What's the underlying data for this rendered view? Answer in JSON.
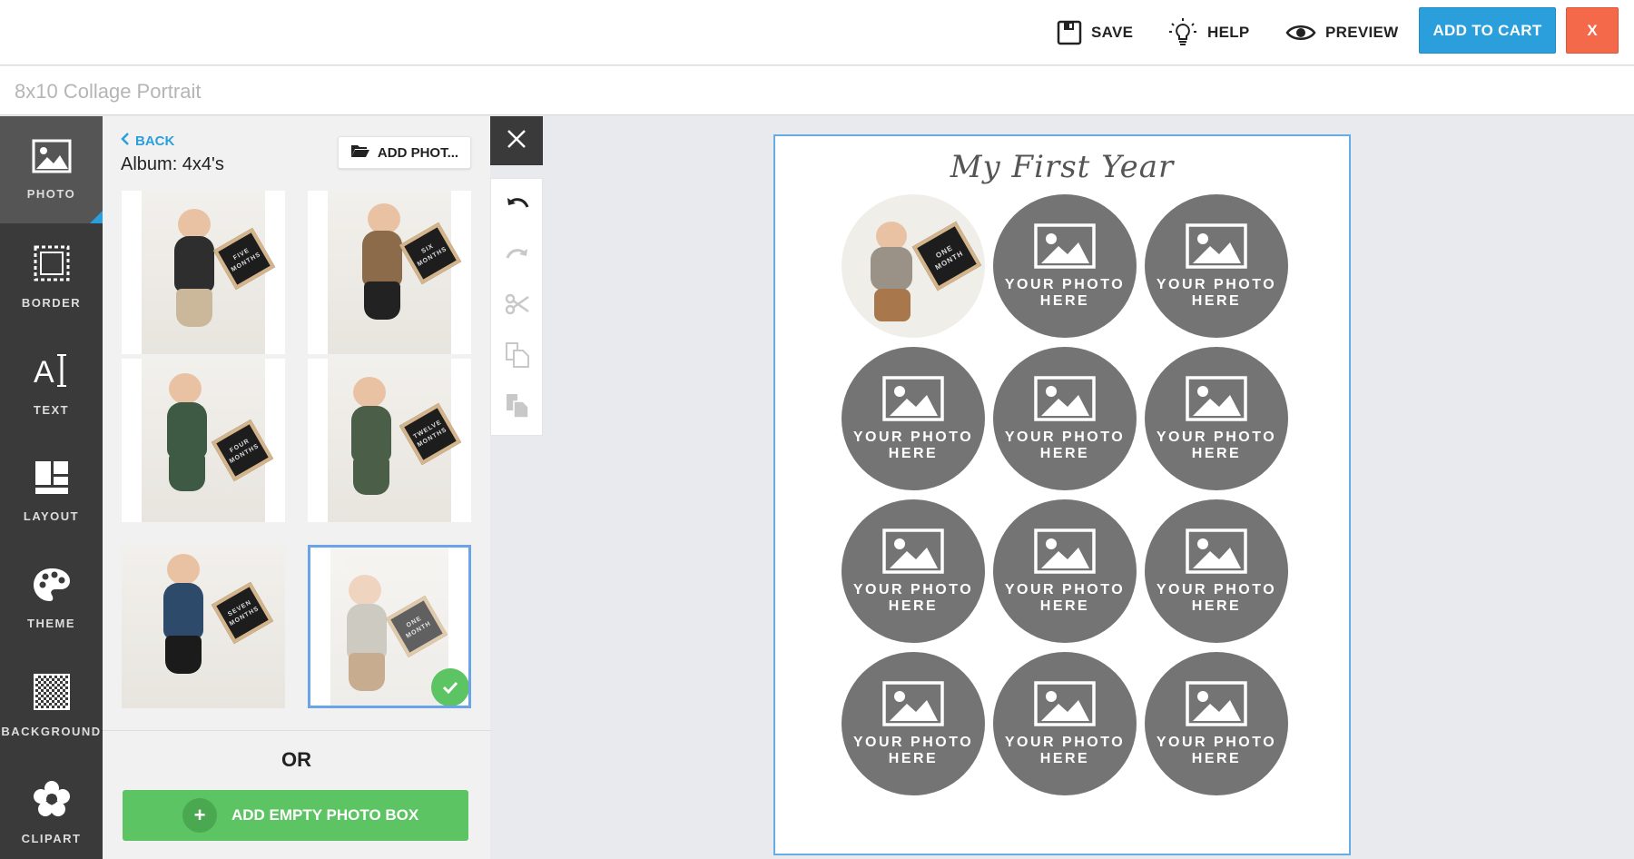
{
  "topbar": {
    "save_label": "SAVE",
    "help_label": "HELP",
    "preview_label": "PREVIEW",
    "cart_label": "ADD TO CART",
    "close_label": "X"
  },
  "project": {
    "title": "8x10 Collage Portrait"
  },
  "sidebar": {
    "items": [
      {
        "label": "PHOTO",
        "icon": "photo-icon",
        "active": true
      },
      {
        "label": "BORDER",
        "icon": "border-icon"
      },
      {
        "label": "TEXT",
        "icon": "text-icon"
      },
      {
        "label": "LAYOUT",
        "icon": "layout-icon"
      },
      {
        "label": "THEME",
        "icon": "palette-icon"
      },
      {
        "label": "BACKGROUND",
        "icon": "checkerboard-icon"
      },
      {
        "label": "CLIPART",
        "icon": "flower-icon"
      }
    ]
  },
  "panel": {
    "back_label": "BACK",
    "album_title": "Album: 4x4's",
    "add_photos_label": "ADD PHOT...",
    "photos": [
      {
        "board_text": "FIVE MONTHS"
      },
      {
        "board_text": "SIX MONTHS"
      },
      {
        "board_text": "FOUR MONTHS"
      },
      {
        "board_text": "TWELVE MONTHS"
      },
      {
        "board_text": "SEVEN MONTHS"
      },
      {
        "board_text": "ONE MONTH",
        "selected": true
      }
    ],
    "or_label": "OR",
    "add_empty_label": "ADD EMPTY PHOTO BOX"
  },
  "canvas": {
    "title": "My First Year",
    "placeholder_line1": "YOUR PHOTO",
    "placeholder_line2": "HERE",
    "filled_board_text": "ONE MONTH"
  },
  "colors": {
    "accent_blue": "#2b9fdc",
    "cart_blue": "#2b9fdc",
    "close_red": "#f4694a",
    "success_green": "#5cc463",
    "sidebar_dark": "#3a3a3a",
    "placeholder_grey": "#747474"
  }
}
